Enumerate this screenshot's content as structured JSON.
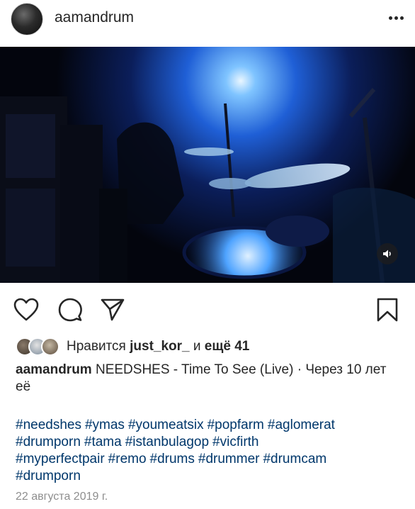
{
  "header": {
    "username": "aamandrum",
    "more_icon": "more-horizontal-icon"
  },
  "media": {
    "type": "video",
    "sound_icon": "speaker-icon"
  },
  "actions": {
    "like_icon": "heart-icon",
    "comment_icon": "comment-bubble-icon",
    "share_icon": "paper-plane-icon",
    "save_icon": "bookmark-icon"
  },
  "likes": {
    "prefix": "Нравится",
    "user": "just_kor_",
    "conj": "и",
    "others": "ещё 41"
  },
  "caption": {
    "username": "aamandrum",
    "text": "NEEDSHES - Time To See (Live) · Через 10 лет её"
  },
  "hashtags": [
    "#needshes",
    "#ymas",
    "#youmeatsix",
    "#popfarm",
    "#aglomerat",
    "#drumporn",
    "#tama",
    "#istanbulagop",
    "#vicfirth",
    "#myperfectpair",
    "#remo",
    "#drums",
    "#drummer",
    "#drumcam",
    "#drumporn"
  ],
  "date": "22 августа 2019 г.",
  "colors": {
    "text": "#262626",
    "link": "#00376b",
    "muted": "#8e8e8e",
    "stage_blue": "#1a6cff"
  }
}
